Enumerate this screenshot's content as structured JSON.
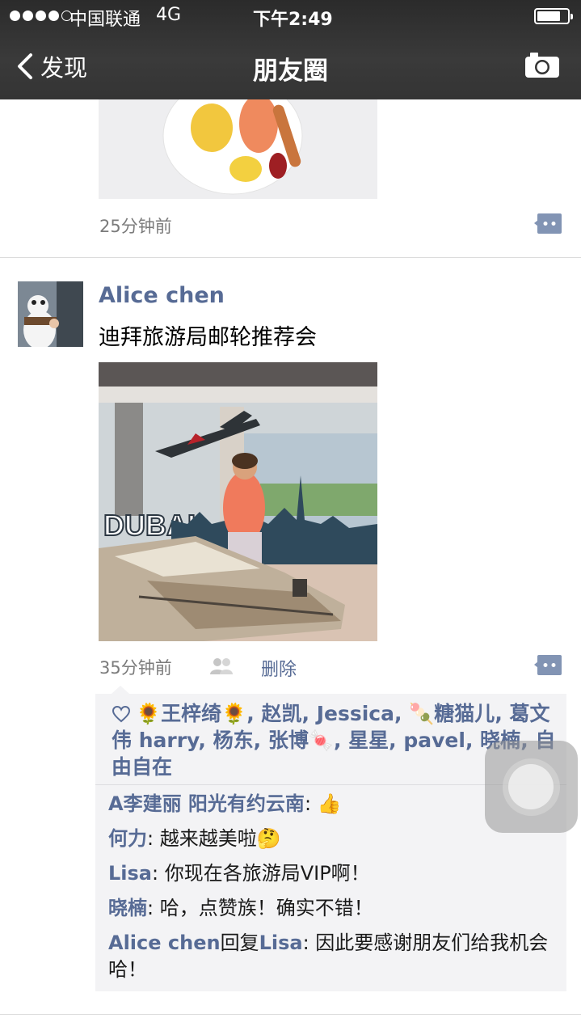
{
  "status_bar": {
    "carrier": "中国联通",
    "network": "4G",
    "time": "下午2:49"
  },
  "nav": {
    "back_label": "发现",
    "title": "朋友圈"
  },
  "post1": {
    "time": "25分钟前"
  },
  "post2": {
    "author": "Alice chen",
    "text": "迪拜旅游局邮轮推荐会",
    "time": "35分钟前",
    "delete_label": "删除",
    "image_sign_text": "DUBAI",
    "likes": [
      "🌻王梓绮🌻",
      "赵凯",
      "Jessica",
      "🍡糖猫儿",
      "葛文伟  harry",
      "杨东",
      "张博🍬",
      "星星",
      "pavel",
      "晓楠",
      "自由自在"
    ],
    "comments": [
      {
        "author": "A李建丽 阳光有约云南",
        "text": "👍"
      },
      {
        "author": "何力",
        "text": "越来越美啦🤔"
      },
      {
        "author": "Lisa",
        "text": "你现在各旅游局VIP啊！"
      },
      {
        "author": "晓楠",
        "text": "哈，点赞族！确实不错！"
      },
      {
        "author": "Alice chen",
        "reply_word": "回复",
        "reply_to": "Lisa",
        "text": "因此要感谢朋友们给我机会哈！"
      }
    ]
  },
  "colors": {
    "link_blue": "#576b95",
    "header_bg": "#343434",
    "interaction_bg": "#f3f3f5"
  },
  "icons": [
    "back-chevron-icon",
    "camera-icon",
    "comment-icon",
    "people-icon",
    "heart-icon",
    "assistive-touch-icon"
  ]
}
